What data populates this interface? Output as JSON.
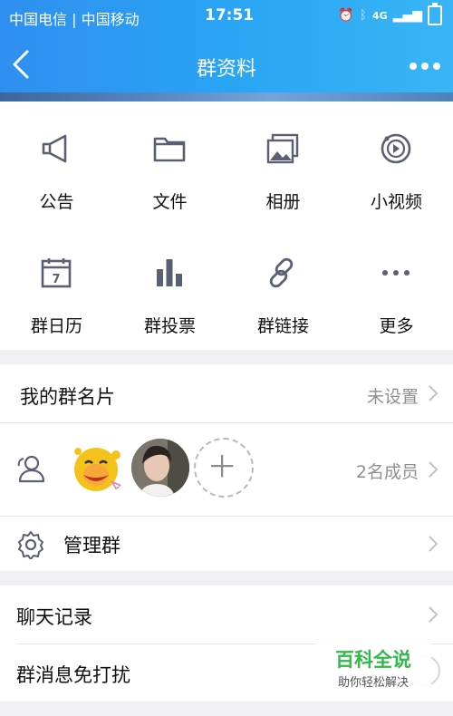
{
  "status_bar": {
    "carriers": "中国电信 | 中国移动",
    "time": "17:51",
    "network": "4G"
  },
  "nav": {
    "title": "群资料"
  },
  "features": [
    {
      "label": "公告",
      "icon": "megaphone-icon"
    },
    {
      "label": "文件",
      "icon": "folder-icon"
    },
    {
      "label": "相册",
      "icon": "photo-album-icon"
    },
    {
      "label": "小视频",
      "icon": "video-icon"
    },
    {
      "label": "群日历",
      "icon": "calendar-icon"
    },
    {
      "label": "群投票",
      "icon": "bar-chart-icon"
    },
    {
      "label": "群链接",
      "icon": "link-icon"
    },
    {
      "label": "更多",
      "icon": "more-dots-icon"
    }
  ],
  "calendar_day": "7",
  "card": {
    "label": "我的群名片",
    "value": "未设置"
  },
  "members": {
    "count_label": "2名成员"
  },
  "manage": {
    "label": "管理群"
  },
  "chat_history": {
    "label": "聊天记录"
  },
  "mute": {
    "label": "群消息免打扰"
  },
  "watermark": {
    "title": "百科全说",
    "subtitle": "助你轻松解决"
  },
  "colors": {
    "accent": "#2f8ff0",
    "icon": "#5a6073",
    "brand_green": "#33b84a"
  }
}
